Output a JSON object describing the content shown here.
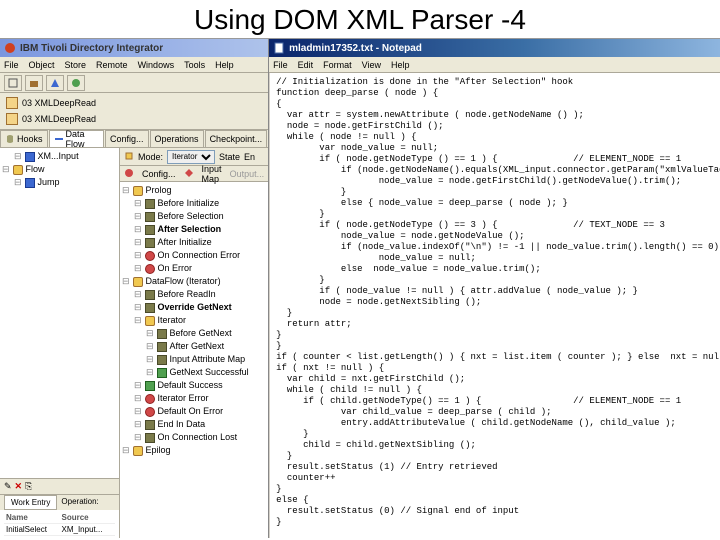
{
  "slide": {
    "title": "Using DOM XML Parser -4"
  },
  "ibm": {
    "titlebar": "IBM Tivoli Directory Integrator",
    "menu": [
      "File",
      "Object",
      "Store",
      "Remote",
      "Windows",
      "Tools",
      "Help"
    ],
    "crumbs": [
      {
        "label": "03 XMLDeepRead"
      },
      {
        "label": "03 XMLDeepRead"
      }
    ],
    "tabs": [
      "Hooks",
      "Data Flow",
      "Config...",
      "Operations",
      "Checkpoint..."
    ],
    "active_tab": 1,
    "left_tree": [
      {
        "icon": "blue",
        "label": "XM...Input",
        "indent": 1
      },
      {
        "icon": "yellow",
        "label": "Flow",
        "indent": 0
      },
      {
        "icon": "blue",
        "label": "Jump",
        "indent": 1
      }
    ],
    "right_toolbar": {
      "mode_label": "Mode:",
      "mode_value": "Iterator",
      "state_label": "State",
      "state_value": "En"
    },
    "right_tabs": [
      "Config...",
      "Input Map",
      "Output..."
    ],
    "hook_tree": [
      {
        "icon": "yellow",
        "label": "Prolog",
        "indent": 0
      },
      {
        "icon": "puzzle",
        "label": "Before Initialize",
        "indent": 1
      },
      {
        "icon": "puzzle",
        "label": "Before Selection",
        "indent": 1
      },
      {
        "icon": "puzzle",
        "label": "After Selection",
        "indent": 1,
        "bold": true
      },
      {
        "icon": "puzzle",
        "label": "After Initialize",
        "indent": 1
      },
      {
        "icon": "red",
        "label": "On Connection Error",
        "indent": 1
      },
      {
        "icon": "red",
        "label": "On Error",
        "indent": 1
      },
      {
        "icon": "yellow",
        "label": "DataFlow (Iterator)",
        "indent": 0
      },
      {
        "icon": "puzzle",
        "label": "Before ReadIn",
        "indent": 1
      },
      {
        "icon": "puzzle",
        "label": "Override GetNext",
        "indent": 1,
        "bold": true
      },
      {
        "icon": "yellow",
        "label": "Iterator",
        "indent": 1
      },
      {
        "icon": "puzzle",
        "label": "Before GetNext",
        "indent": 2
      },
      {
        "icon": "puzzle",
        "label": "After GetNext",
        "indent": 2
      },
      {
        "icon": "puzzle",
        "label": "Input Attribute Map",
        "indent": 2
      },
      {
        "icon": "green",
        "label": "GetNext Successful",
        "indent": 2
      },
      {
        "icon": "green",
        "label": "Default Success",
        "indent": 1
      },
      {
        "icon": "red",
        "label": "Iterator Error",
        "indent": 1
      },
      {
        "icon": "red",
        "label": "Default On Error",
        "indent": 1
      },
      {
        "icon": "puzzle",
        "label": "End In Data",
        "indent": 1
      },
      {
        "icon": "puzzle",
        "label": "On Connection Lost",
        "indent": 1
      },
      {
        "icon": "yellow",
        "label": "Epilog",
        "indent": 0
      }
    ],
    "work_entry": {
      "tab": "Work Entry",
      "op_label": "Operation:",
      "headers": [
        "Name",
        "Source"
      ],
      "rows": [
        [
          "InitialSelect",
          "XM_Input..."
        ]
      ]
    }
  },
  "notepad": {
    "title": "mladmin17352.txt - Notepad",
    "menu": [
      "File",
      "Edit",
      "Format",
      "View",
      "Help"
    ],
    "code": "// Initialization is done in the \"After Selection\" hook\nfunction deep_parse ( node ) {\n{\n  var attr = system.newAttribute ( node.getNodeName () );\n  node = node.getFirstChild ();\n  while ( node != null ) {\n        var node_value = null;\n        if ( node.getNodeType () == 1 ) {              // ELEMENT_NODE == 1\n            if (node.getNodeName().equals(XML_input.connector.getParam(\"xmlValueTag\"))) {\n                   node_value = node.getFirstChild().getNodeValue().trim();\n            }\n            else { node_value = deep_parse ( node ); }\n        }\n        if ( node.getNodeType () == 3 ) {              // TEXT_NODE == 3\n            node_value = node.getNodeValue ();\n            if (node_value.indexOf(\"\\n\") != -1 || node_value.trim().length() == 0)\n                   node_value = null;\n            else  node_value = node_value.trim();\n        }\n        if ( node_value != null ) { attr.addValue ( node_value ); }\n        node = node.getNextSibling ();\n  }\n  return attr;\n}\n}\nif ( counter < list.getLength() ) { nxt = list.item ( counter ); } else  nxt = null\nif ( nxt != null ) {\n  var child = nxt.getFirstChild ();\n  while ( child != null ) {\n     if ( child.getNodeType() == 1 ) {                 // ELEMENT_NODE == 1\n            var child_value = deep_parse ( child );\n            entry.addAttributeValue ( child.getNodeName (), child_value );\n     }\n     child = child.getNextSibling ();\n  }\n  result.setStatus (1) // Entry retrieved\n  counter++\n}\nelse {\n  result.setStatus (0) // Signal end of input\n}"
  }
}
